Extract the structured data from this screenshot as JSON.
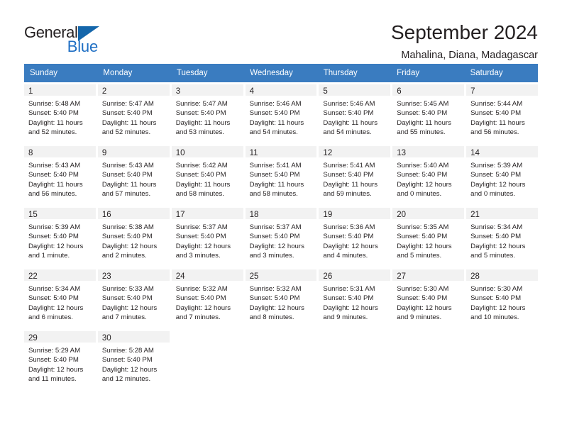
{
  "logo": {
    "line1": "General",
    "line2": "Blue",
    "triangle_color": "#1466ab",
    "blue_color": "#1f6fc4"
  },
  "header": {
    "title": "September 2024",
    "subtitle": "Mahalina, Diana, Madagascar"
  },
  "theme": {
    "header_row_bg": "#3a7cc0",
    "header_row_text": "#ffffff",
    "daynum_band_bg": "#f2f2f2",
    "text_color": "#231f20"
  },
  "weekdays": [
    "Sunday",
    "Monday",
    "Tuesday",
    "Wednesday",
    "Thursday",
    "Friday",
    "Saturday"
  ],
  "weeks": [
    [
      {
        "day": "1",
        "sunrise": "Sunrise: 5:48 AM",
        "sunset": "Sunset: 5:40 PM",
        "daylight": "Daylight: 11 hours and 52 minutes."
      },
      {
        "day": "2",
        "sunrise": "Sunrise: 5:47 AM",
        "sunset": "Sunset: 5:40 PM",
        "daylight": "Daylight: 11 hours and 52 minutes."
      },
      {
        "day": "3",
        "sunrise": "Sunrise: 5:47 AM",
        "sunset": "Sunset: 5:40 PM",
        "daylight": "Daylight: 11 hours and 53 minutes."
      },
      {
        "day": "4",
        "sunrise": "Sunrise: 5:46 AM",
        "sunset": "Sunset: 5:40 PM",
        "daylight": "Daylight: 11 hours and 54 minutes."
      },
      {
        "day": "5",
        "sunrise": "Sunrise: 5:46 AM",
        "sunset": "Sunset: 5:40 PM",
        "daylight": "Daylight: 11 hours and 54 minutes."
      },
      {
        "day": "6",
        "sunrise": "Sunrise: 5:45 AM",
        "sunset": "Sunset: 5:40 PM",
        "daylight": "Daylight: 11 hours and 55 minutes."
      },
      {
        "day": "7",
        "sunrise": "Sunrise: 5:44 AM",
        "sunset": "Sunset: 5:40 PM",
        "daylight": "Daylight: 11 hours and 56 minutes."
      }
    ],
    [
      {
        "day": "8",
        "sunrise": "Sunrise: 5:43 AM",
        "sunset": "Sunset: 5:40 PM",
        "daylight": "Daylight: 11 hours and 56 minutes."
      },
      {
        "day": "9",
        "sunrise": "Sunrise: 5:43 AM",
        "sunset": "Sunset: 5:40 PM",
        "daylight": "Daylight: 11 hours and 57 minutes."
      },
      {
        "day": "10",
        "sunrise": "Sunrise: 5:42 AM",
        "sunset": "Sunset: 5:40 PM",
        "daylight": "Daylight: 11 hours and 58 minutes."
      },
      {
        "day": "11",
        "sunrise": "Sunrise: 5:41 AM",
        "sunset": "Sunset: 5:40 PM",
        "daylight": "Daylight: 11 hours and 58 minutes."
      },
      {
        "day": "12",
        "sunrise": "Sunrise: 5:41 AM",
        "sunset": "Sunset: 5:40 PM",
        "daylight": "Daylight: 11 hours and 59 minutes."
      },
      {
        "day": "13",
        "sunrise": "Sunrise: 5:40 AM",
        "sunset": "Sunset: 5:40 PM",
        "daylight": "Daylight: 12 hours and 0 minutes."
      },
      {
        "day": "14",
        "sunrise": "Sunrise: 5:39 AM",
        "sunset": "Sunset: 5:40 PM",
        "daylight": "Daylight: 12 hours and 0 minutes."
      }
    ],
    [
      {
        "day": "15",
        "sunrise": "Sunrise: 5:39 AM",
        "sunset": "Sunset: 5:40 PM",
        "daylight": "Daylight: 12 hours and 1 minute."
      },
      {
        "day": "16",
        "sunrise": "Sunrise: 5:38 AM",
        "sunset": "Sunset: 5:40 PM",
        "daylight": "Daylight: 12 hours and 2 minutes."
      },
      {
        "day": "17",
        "sunrise": "Sunrise: 5:37 AM",
        "sunset": "Sunset: 5:40 PM",
        "daylight": "Daylight: 12 hours and 3 minutes."
      },
      {
        "day": "18",
        "sunrise": "Sunrise: 5:37 AM",
        "sunset": "Sunset: 5:40 PM",
        "daylight": "Daylight: 12 hours and 3 minutes."
      },
      {
        "day": "19",
        "sunrise": "Sunrise: 5:36 AM",
        "sunset": "Sunset: 5:40 PM",
        "daylight": "Daylight: 12 hours and 4 minutes."
      },
      {
        "day": "20",
        "sunrise": "Sunrise: 5:35 AM",
        "sunset": "Sunset: 5:40 PM",
        "daylight": "Daylight: 12 hours and 5 minutes."
      },
      {
        "day": "21",
        "sunrise": "Sunrise: 5:34 AM",
        "sunset": "Sunset: 5:40 PM",
        "daylight": "Daylight: 12 hours and 5 minutes."
      }
    ],
    [
      {
        "day": "22",
        "sunrise": "Sunrise: 5:34 AM",
        "sunset": "Sunset: 5:40 PM",
        "daylight": "Daylight: 12 hours and 6 minutes."
      },
      {
        "day": "23",
        "sunrise": "Sunrise: 5:33 AM",
        "sunset": "Sunset: 5:40 PM",
        "daylight": "Daylight: 12 hours and 7 minutes."
      },
      {
        "day": "24",
        "sunrise": "Sunrise: 5:32 AM",
        "sunset": "Sunset: 5:40 PM",
        "daylight": "Daylight: 12 hours and 7 minutes."
      },
      {
        "day": "25",
        "sunrise": "Sunrise: 5:32 AM",
        "sunset": "Sunset: 5:40 PM",
        "daylight": "Daylight: 12 hours and 8 minutes."
      },
      {
        "day": "26",
        "sunrise": "Sunrise: 5:31 AM",
        "sunset": "Sunset: 5:40 PM",
        "daylight": "Daylight: 12 hours and 9 minutes."
      },
      {
        "day": "27",
        "sunrise": "Sunrise: 5:30 AM",
        "sunset": "Sunset: 5:40 PM",
        "daylight": "Daylight: 12 hours and 9 minutes."
      },
      {
        "day": "28",
        "sunrise": "Sunrise: 5:30 AM",
        "sunset": "Sunset: 5:40 PM",
        "daylight": "Daylight: 12 hours and 10 minutes."
      }
    ],
    [
      {
        "day": "29",
        "sunrise": "Sunrise: 5:29 AM",
        "sunset": "Sunset: 5:40 PM",
        "daylight": "Daylight: 12 hours and 11 minutes."
      },
      {
        "day": "30",
        "sunrise": "Sunrise: 5:28 AM",
        "sunset": "Sunset: 5:40 PM",
        "daylight": "Daylight: 12 hours and 12 minutes."
      },
      {
        "day": "",
        "sunrise": "",
        "sunset": "",
        "daylight": ""
      },
      {
        "day": "",
        "sunrise": "",
        "sunset": "",
        "daylight": ""
      },
      {
        "day": "",
        "sunrise": "",
        "sunset": "",
        "daylight": ""
      },
      {
        "day": "",
        "sunrise": "",
        "sunset": "",
        "daylight": ""
      },
      {
        "day": "",
        "sunrise": "",
        "sunset": "",
        "daylight": ""
      }
    ]
  ]
}
